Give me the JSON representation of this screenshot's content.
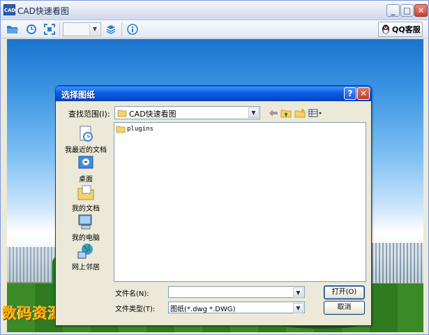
{
  "app": {
    "title": "CAD快速看图",
    "logo_text": "CAD",
    "window_controls": {
      "minimize": "_",
      "maximize": "□",
      "close": "✕"
    }
  },
  "toolbar": {
    "qq_service_label": "QQ客服",
    "zoom_select": {
      "value": ""
    }
  },
  "watermark": "数码资源 Smzy.Com",
  "dialog": {
    "title": "选择图纸",
    "help_label": "?",
    "close_label": "✕",
    "look_in": {
      "label": "查找范围(I):",
      "value": "CAD快速看图"
    },
    "places": [
      {
        "label": "我最近的文档",
        "icon": "recent-documents-icon"
      },
      {
        "label": "桌面",
        "icon": "desktop-icon"
      },
      {
        "label": "我的文档",
        "icon": "my-documents-icon"
      },
      {
        "label": "我的电脑",
        "icon": "my-computer-icon"
      },
      {
        "label": "网上邻居",
        "icon": "network-places-icon"
      }
    ],
    "files": [
      {
        "name": "plugins",
        "icon": "folder-icon"
      }
    ],
    "file_name": {
      "label": "文件名(N):",
      "value": ""
    },
    "file_type": {
      "label": "文件类型(T):",
      "value": "图纸(*.dwg *.DWG)"
    },
    "open_label": "打开(O)",
    "cancel_label": "取消"
  }
}
